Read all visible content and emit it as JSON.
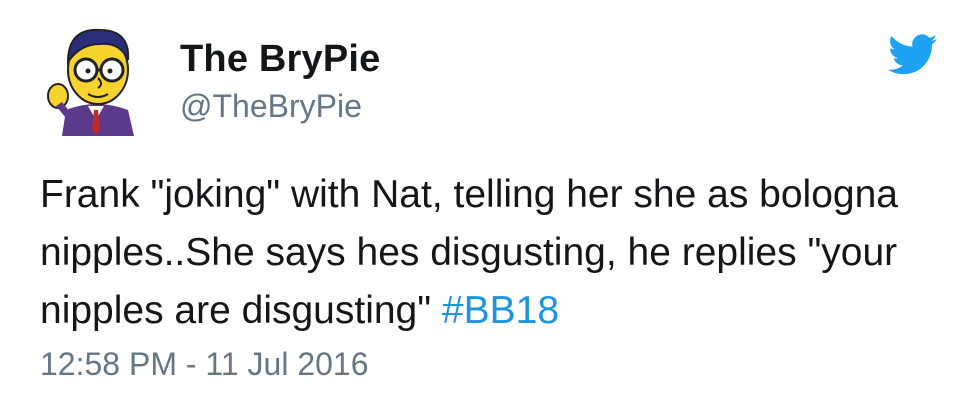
{
  "author": {
    "display_name": "The BryPie",
    "handle": "@TheBryPie"
  },
  "tweet": {
    "text_before_hashtag": "Frank \"joking\" with Nat, telling her she as bologna nipples..She says hes disgusting, he replies \"your nipples are disgusting\" ",
    "hashtag": "#BB18",
    "timestamp": "12:58 PM - 11 Jul 2016"
  },
  "icons": {
    "logo": "twitter-bird-icon",
    "avatar": "cartoon-avatar"
  },
  "colors": {
    "text": "#14171a",
    "muted": "#657786",
    "link": "#1b95e0",
    "twitter_blue": "#1da1f2"
  }
}
